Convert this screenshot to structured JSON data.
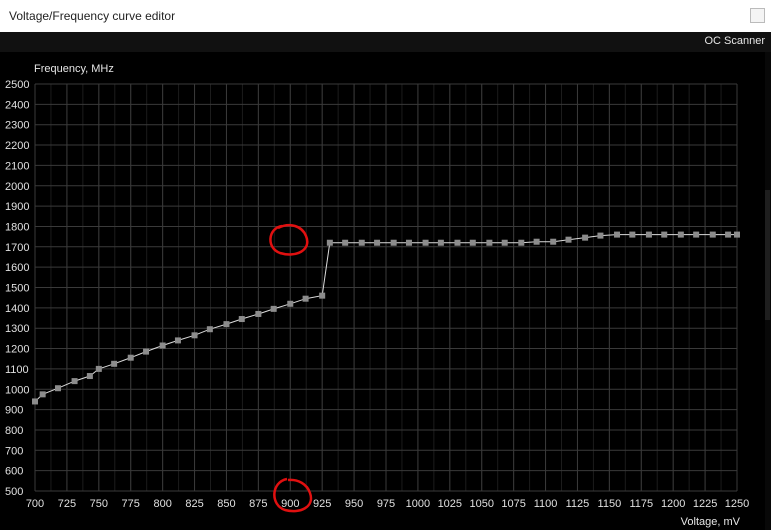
{
  "window": {
    "title": "Voltage/Frequency curve editor"
  },
  "toolbar": {
    "oc_scanner_label": "OC Scanner"
  },
  "colors": {
    "background": "#000000",
    "grid": "#3a3a3a",
    "curve": "#dcdcdc",
    "point": "#8c8c8c",
    "annotation": "#e01010"
  },
  "chart_data": {
    "type": "line",
    "xlabel": "Voltage, mV",
    "ylabel": "Frequency, MHz",
    "xlim": [
      700,
      1250
    ],
    "ylim": [
      500,
      2500
    ],
    "xticks": [
      700,
      725,
      750,
      775,
      800,
      825,
      850,
      875,
      900,
      925,
      950,
      975,
      1000,
      1025,
      1050,
      1075,
      1100,
      1125,
      1150,
      1175,
      1200,
      1225,
      1250
    ],
    "yticks": [
      500,
      600,
      700,
      800,
      900,
      1000,
      1100,
      1200,
      1300,
      1400,
      1500,
      1600,
      1700,
      1800,
      1900,
      2000,
      2100,
      2200,
      2300,
      2400,
      2500
    ],
    "grid": true,
    "series": [
      {
        "x": [
          700,
          706,
          712,
          718,
          725,
          731,
          737,
          743,
          750,
          756,
          762,
          768,
          775,
          781,
          787,
          793,
          800,
          806,
          812,
          818,
          825,
          831,
          837,
          843,
          850,
          856,
          862,
          868,
          875,
          881,
          887,
          893,
          900,
          906,
          912,
          918,
          925,
          931,
          937,
          943,
          950,
          956,
          962,
          968,
          975,
          981,
          987,
          993,
          1000,
          1006,
          1012,
          1018,
          1025,
          1031,
          1037,
          1043,
          1050,
          1056,
          1062,
          1068,
          1075,
          1081,
          1087,
          1093,
          1100,
          1106,
          1112,
          1118,
          1125,
          1131,
          1137,
          1143,
          1150,
          1156,
          1162,
          1168,
          1175,
          1181,
          1187,
          1193,
          1200,
          1206,
          1212,
          1218,
          1225,
          1231,
          1237,
          1243,
          1250
        ],
        "y": [
          940,
          960,
          980,
          990,
          1000,
          1020,
          1040,
          1050,
          1065,
          1090,
          1110,
          1115,
          1130,
          1145,
          1160,
          1180,
          1190,
          1205,
          1220,
          1235,
          1250,
          1260,
          1270,
          1285,
          1300,
          1315,
          1325,
          1340,
          1350,
          1365,
          1380,
          1395,
          1400,
          1410,
          1420,
          1435,
          1445,
          1455,
          1460,
          1465,
          1720,
          1720,
          1720,
          1720,
          1720,
          1720,
          1720,
          1720,
          1720,
          1720,
          1720,
          1720,
          1720,
          1720,
          1720,
          1720,
          1720,
          1720,
          1725,
          1725,
          1725,
          1725,
          1725,
          1735,
          1745,
          1750,
          1750,
          1750,
          1755,
          1760,
          1760,
          1760,
          1760,
          1760,
          1760,
          1760,
          1760,
          1760,
          1760,
          1760,
          1760,
          1760,
          1760,
          1760,
          1760,
          1760,
          1760,
          1760,
          1760
        ],
        "marker_x": [
          700,
          706,
          712,
          718,
          725,
          731,
          737,
          743,
          750,
          756,
          762,
          768,
          775,
          781,
          787,
          793,
          800,
          806,
          812,
          818,
          825,
          831,
          837,
          843,
          850,
          856,
          862,
          868,
          875,
          881,
          887,
          893
        ],
        "marker_points": [
          [
            700,
            940
          ],
          [
            706,
            975
          ],
          [
            718,
            1005
          ],
          [
            731,
            1040
          ],
          [
            743,
            1065
          ],
          [
            750,
            1100
          ],
          [
            762,
            1125
          ],
          [
            775,
            1155
          ],
          [
            787,
            1185
          ],
          [
            800,
            1215
          ],
          [
            812,
            1240
          ],
          [
            825,
            1265
          ],
          [
            837,
            1295
          ],
          [
            850,
            1320
          ],
          [
            862,
            1345
          ],
          [
            875,
            1370
          ],
          [
            887,
            1395
          ],
          [
            900,
            1420
          ],
          [
            912,
            1445
          ],
          [
            925,
            1460
          ],
          [
            931,
            1720
          ],
          [
            943,
            1720
          ],
          [
            956,
            1720
          ],
          [
            968,
            1720
          ],
          [
            981,
            1720
          ],
          [
            993,
            1720
          ],
          [
            1006,
            1720
          ],
          [
            1018,
            1720
          ],
          [
            1031,
            1720
          ],
          [
            1043,
            1720
          ],
          [
            1056,
            1720
          ],
          [
            1068,
            1720
          ],
          [
            1081,
            1720
          ],
          [
            1093,
            1725
          ],
          [
            1106,
            1725
          ],
          [
            1118,
            1735
          ],
          [
            1131,
            1745
          ],
          [
            1143,
            1755
          ],
          [
            1156,
            1760
          ],
          [
            1168,
            1760
          ],
          [
            1181,
            1760
          ],
          [
            1193,
            1760
          ],
          [
            1206,
            1760
          ],
          [
            1218,
            1760
          ],
          [
            1231,
            1760
          ],
          [
            1243,
            1760
          ],
          [
            1250,
            1760
          ]
        ]
      }
    ]
  }
}
